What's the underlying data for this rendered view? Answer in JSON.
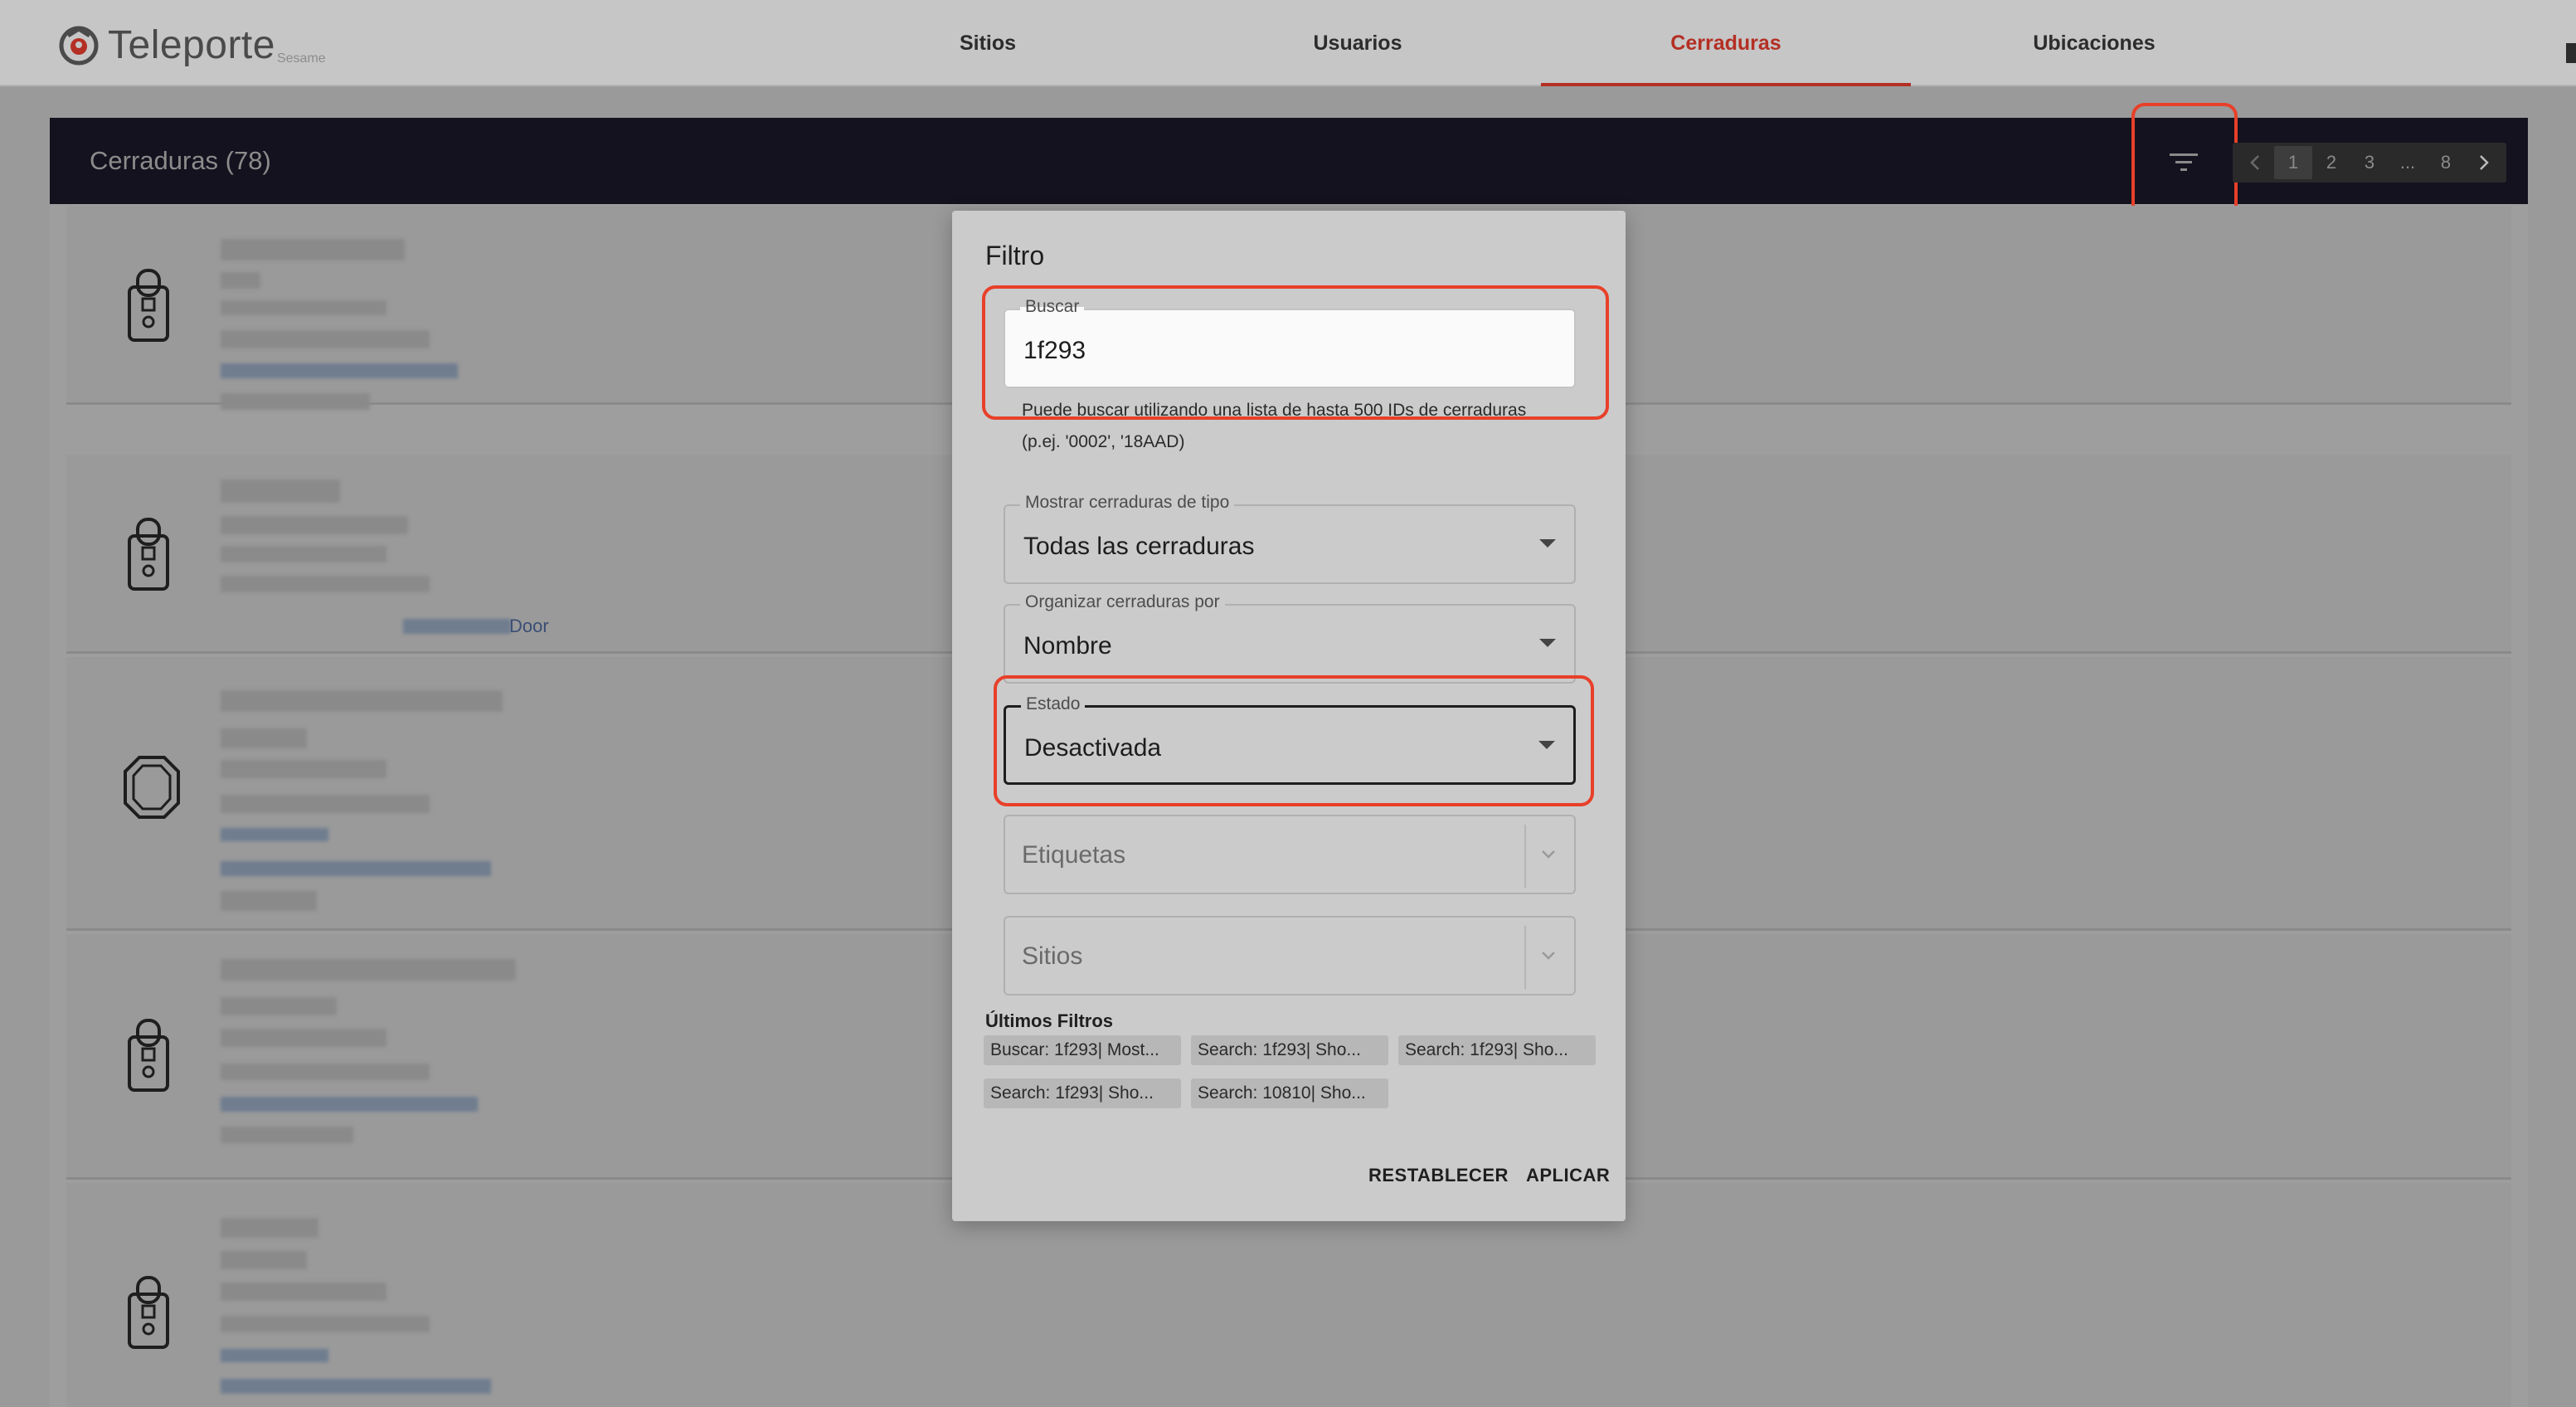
{
  "app": {
    "logo_text": "Teleporte",
    "logo_subtext": "Sesame"
  },
  "nav": {
    "tabs": [
      {
        "label": "Sitios",
        "active": false
      },
      {
        "label": "Usuarios",
        "active": false
      },
      {
        "label": "Cerraduras",
        "active": true
      },
      {
        "label": "Ubicaciones",
        "active": false
      }
    ]
  },
  "header": {
    "title": "Cerraduras (78)",
    "filter_icon": "filter-list-icon",
    "pagination": {
      "prev_icon": "chevron-left-icon",
      "pages": [
        "1",
        "2",
        "3",
        "...",
        "8"
      ],
      "current": "1",
      "next_icon": "chevron-right-icon"
    }
  },
  "list": {
    "visible_link_text": "Door"
  },
  "modal": {
    "title": "Filtro",
    "search": {
      "label": "Buscar",
      "value": "1f293",
      "helper_line1": "Puede buscar utilizando una lista de hasta 500 IDs de cerraduras",
      "helper_line2": "(p.ej. '0002', '18AAD)"
    },
    "lock_type": {
      "label": "Mostrar cerraduras de tipo",
      "value": "Todas las cerraduras"
    },
    "sort": {
      "label": "Organizar cerraduras por",
      "value": "Nombre"
    },
    "status": {
      "label": "Estado",
      "value": "Desactivada"
    },
    "tags": {
      "placeholder": "Etiquetas"
    },
    "sites": {
      "placeholder": "Sitios"
    },
    "recent": {
      "title": "Últimos Filtros",
      "chips": [
        "Buscar: 1f293| Most...",
        "Search: 1f293| Sho...",
        "Search: 1f293| Sho...",
        "Search: 1f293| Sho...",
        "Search: 10810| Sho..."
      ]
    },
    "reset_label": "RESTABLECER",
    "apply_label": "APLICAR"
  },
  "colors": {
    "accent": "#b42f24",
    "highlight": "#e8402a",
    "header_bg": "#13121e"
  }
}
